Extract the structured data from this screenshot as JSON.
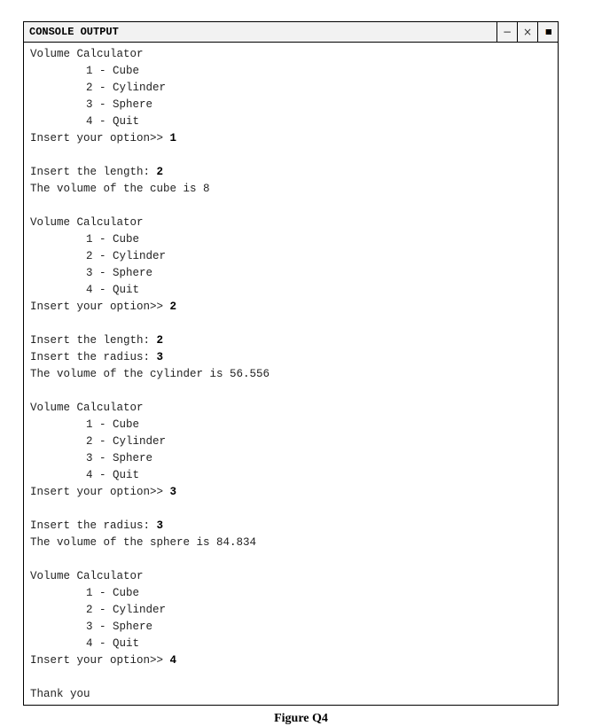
{
  "window": {
    "title": "CONSOLE OUTPUT",
    "controls": {
      "minimize": "−",
      "close": "×",
      "maximize": "■"
    }
  },
  "console": {
    "lines": [
      {
        "text": "Volume Calculator",
        "indent": false,
        "input": ""
      },
      {
        "text": "1 - Cube",
        "indent": true,
        "input": ""
      },
      {
        "text": "2 - Cylinder",
        "indent": true,
        "input": ""
      },
      {
        "text": "3 - Sphere",
        "indent": true,
        "input": ""
      },
      {
        "text": "4 - Quit",
        "indent": true,
        "input": ""
      },
      {
        "text": "Insert your option>> ",
        "indent": false,
        "input": "1"
      },
      {
        "text": "",
        "indent": false,
        "input": ""
      },
      {
        "text": "Insert the length: ",
        "indent": false,
        "input": "2"
      },
      {
        "text": "The volume of the cube is 8",
        "indent": false,
        "input": ""
      },
      {
        "text": "",
        "indent": false,
        "input": ""
      },
      {
        "text": "Volume Calculator",
        "indent": false,
        "input": ""
      },
      {
        "text": "1 - Cube",
        "indent": true,
        "input": ""
      },
      {
        "text": "2 - Cylinder",
        "indent": true,
        "input": ""
      },
      {
        "text": "3 - Sphere",
        "indent": true,
        "input": ""
      },
      {
        "text": "4 - Quit",
        "indent": true,
        "input": ""
      },
      {
        "text": "Insert your option>> ",
        "indent": false,
        "input": "2"
      },
      {
        "text": "",
        "indent": false,
        "input": ""
      },
      {
        "text": "Insert the length: ",
        "indent": false,
        "input": "2"
      },
      {
        "text": "Insert the radius: ",
        "indent": false,
        "input": "3"
      },
      {
        "text": "The volume of the cylinder is 56.556",
        "indent": false,
        "input": ""
      },
      {
        "text": "",
        "indent": false,
        "input": ""
      },
      {
        "text": "Volume Calculator",
        "indent": false,
        "input": ""
      },
      {
        "text": "1 - Cube",
        "indent": true,
        "input": ""
      },
      {
        "text": "2 - Cylinder",
        "indent": true,
        "input": ""
      },
      {
        "text": "3 - Sphere",
        "indent": true,
        "input": ""
      },
      {
        "text": "4 - Quit",
        "indent": true,
        "input": ""
      },
      {
        "text": "Insert your option>> ",
        "indent": false,
        "input": "3"
      },
      {
        "text": "",
        "indent": false,
        "input": ""
      },
      {
        "text": "Insert the radius: ",
        "indent": false,
        "input": "3"
      },
      {
        "text": "The volume of the sphere is 84.834",
        "indent": false,
        "input": ""
      },
      {
        "text": "",
        "indent": false,
        "input": ""
      },
      {
        "text": "Volume Calculator",
        "indent": false,
        "input": ""
      },
      {
        "text": "1 - Cube",
        "indent": true,
        "input": ""
      },
      {
        "text": "2 - Cylinder",
        "indent": true,
        "input": ""
      },
      {
        "text": "3 - Sphere",
        "indent": true,
        "input": ""
      },
      {
        "text": "4 - Quit",
        "indent": true,
        "input": ""
      },
      {
        "text": "Insert your option>> ",
        "indent": false,
        "input": "4"
      },
      {
        "text": "",
        "indent": false,
        "input": ""
      },
      {
        "text": "Thank you",
        "indent": false,
        "input": ""
      }
    ]
  },
  "caption": "Figure Q4"
}
